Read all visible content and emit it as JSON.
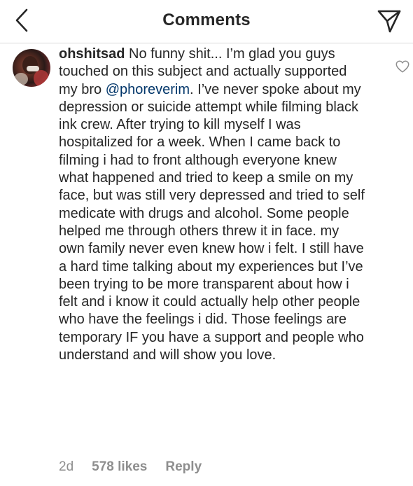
{
  "header": {
    "title": "Comments",
    "back_icon": "chevron-left-icon",
    "share_icon": "direct-share-icon"
  },
  "comment": {
    "username": "ohshitsad",
    "text_before_mention": " No funny shit... I’m glad you guys touched on this subject and actually supported my bro ",
    "mention": "@phoreverim",
    "text_after_mention": ". I’ve never spoke about my depression or suicide attempt while filming black ink crew. After trying to kill myself I was hospitalized for a week. When I came back to filming i had to front although everyone knew what happened and tried to keep a smile on my face, but was still very depressed and tried to self medicate with drugs and alcohol. Some people helped me through others threw it in face. my own family never even knew how i felt. I still have a hard time talking about my experiences but I’ve been trying to be more transparent about how i felt and i know it could actually help other people who have the feelings i did. Those feelings are temporary IF you have a support and people who understand and will show you love.",
    "time": "2d",
    "likes": "578 likes",
    "reply_label": "Reply",
    "like_icon": "heart-outline-icon"
  },
  "colors": {
    "text": "#262626",
    "mention": "#003569",
    "secondary": "#8e8e8e",
    "divider": "#d9d9d9"
  }
}
